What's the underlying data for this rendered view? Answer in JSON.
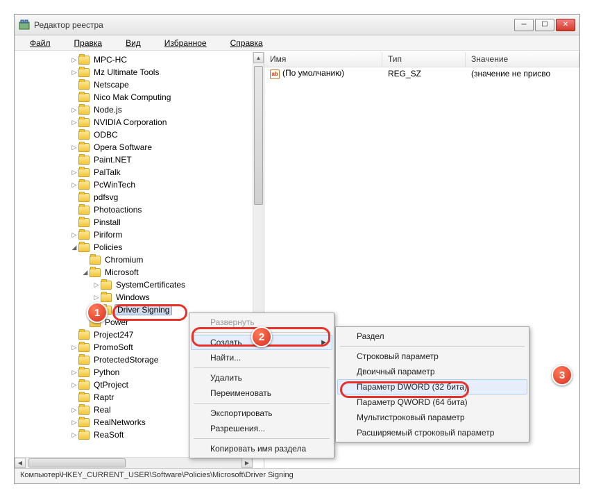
{
  "window": {
    "title": "Редактор реестра"
  },
  "menu": {
    "file": "Файл",
    "edit": "Правка",
    "view": "Вид",
    "favorites": "Избранное",
    "help": "Справка"
  },
  "tree": {
    "items": [
      {
        "indent": 5,
        "exp": "▷",
        "label": "MPC-HC"
      },
      {
        "indent": 5,
        "exp": "▷",
        "label": "Mz Ultimate Tools"
      },
      {
        "indent": 5,
        "exp": "",
        "label": "Netscape"
      },
      {
        "indent": 5,
        "exp": "",
        "label": "Nico Mak Computing"
      },
      {
        "indent": 5,
        "exp": "▷",
        "label": "Node.js"
      },
      {
        "indent": 5,
        "exp": "▷",
        "label": "NVIDIA Corporation"
      },
      {
        "indent": 5,
        "exp": "",
        "label": "ODBC"
      },
      {
        "indent": 5,
        "exp": "▷",
        "label": "Opera Software"
      },
      {
        "indent": 5,
        "exp": "",
        "label": "Paint.NET"
      },
      {
        "indent": 5,
        "exp": "▷",
        "label": "PalTalk"
      },
      {
        "indent": 5,
        "exp": "▷",
        "label": "PcWinTech"
      },
      {
        "indent": 5,
        "exp": "",
        "label": "pdfsvg"
      },
      {
        "indent": 5,
        "exp": "",
        "label": "Photoactions"
      },
      {
        "indent": 5,
        "exp": "",
        "label": "Pinstall"
      },
      {
        "indent": 5,
        "exp": "▷",
        "label": "Piriform"
      },
      {
        "indent": 5,
        "exp": "◢",
        "label": "Policies"
      },
      {
        "indent": 6,
        "exp": "",
        "label": "Chromium"
      },
      {
        "indent": 6,
        "exp": "◢",
        "label": "Microsoft"
      },
      {
        "indent": 7,
        "exp": "▷",
        "label": "SystemCertificates"
      },
      {
        "indent": 7,
        "exp": "▷",
        "label": "Windows"
      },
      {
        "indent": 7,
        "exp": "",
        "label": "Driver Signing",
        "selected": true
      },
      {
        "indent": 6,
        "exp": "",
        "label": "Power"
      },
      {
        "indent": 5,
        "exp": "",
        "label": "Project247"
      },
      {
        "indent": 5,
        "exp": "▷",
        "label": "PromoSoft"
      },
      {
        "indent": 5,
        "exp": "",
        "label": "ProtectedStorage"
      },
      {
        "indent": 5,
        "exp": "▷",
        "label": "Python"
      },
      {
        "indent": 5,
        "exp": "▷",
        "label": "QtProject"
      },
      {
        "indent": 5,
        "exp": "",
        "label": "Raptr"
      },
      {
        "indent": 5,
        "exp": "▷",
        "label": "Real"
      },
      {
        "indent": 5,
        "exp": "▷",
        "label": "RealNetworks"
      },
      {
        "indent": 5,
        "exp": "▷",
        "label": "ReaSoft"
      }
    ]
  },
  "list": {
    "cols": {
      "name": "Имя",
      "type": "Тип",
      "value": "Значение"
    },
    "row": {
      "name": "(По умолчанию)",
      "type": "REG_SZ",
      "value": "(значение не присво"
    }
  },
  "ctx1": {
    "expand": "Развернуть",
    "create": "Создать",
    "find": "Найти...",
    "delete": "Удалить",
    "rename": "Переименовать",
    "export": "Экспортировать",
    "perm": "Разрешения...",
    "copy": "Копировать имя раздела"
  },
  "ctx2": {
    "key": "Раздел",
    "string": "Строковый параметр",
    "binary": "Двоичный параметр",
    "dword": "Параметр DWORD (32 бита)",
    "qword": "Параметр QWORD (64 бита)",
    "multi": "Мультистроковый параметр",
    "expand": "Расширяемый строковый параметр"
  },
  "status": "Компьютер\\HKEY_CURRENT_USER\\Software\\Policies\\Microsoft\\Driver Signing",
  "callouts": {
    "c1": "1",
    "c2": "2",
    "c3": "3"
  }
}
